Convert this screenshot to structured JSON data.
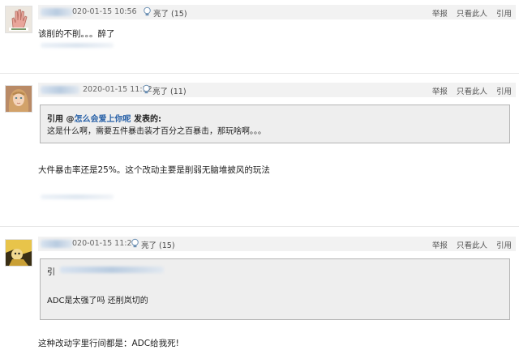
{
  "posts": [
    {
      "timestamp": "020-01-15 10:56",
      "like_label": "亮了",
      "like_count": "(15)",
      "actions": [
        "举报",
        "只看此人",
        "引用"
      ],
      "content": "该削的不削。。。醉了",
      "avatar": "hand-avatar"
    },
    {
      "timestamp": "2020-01-15 11:12",
      "like_label": "亮了",
      "like_count": "(11)",
      "actions": [
        "举报",
        "只看此人",
        "引用"
      ],
      "quote": {
        "prefix": "引用 @",
        "author": "怎么会爱上你呢",
        "suffix": " 发表的:",
        "text": "这是什么啊，需要五件暴击装才百分之百暴击，那玩啥啊。。。"
      },
      "content": "大件暴击率还是25%。这个改动主要是削弱无脑堆披风的玩法",
      "avatar": "girl-avatar"
    },
    {
      "timestamp": "020-01-15 11:26",
      "like_label": "亮了",
      "like_count": "(15)",
      "actions": [
        "举报",
        "只看此人",
        "引用"
      ],
      "quote": {
        "prefix": "引",
        "text": "ADC是太强了吗 还削岚切的"
      },
      "content": "这种改动字里行间都是：ADC给我死!",
      "avatar": "cartoon-avatar"
    }
  ],
  "colors": {
    "header_bg": "#f2f2f2",
    "quote_bg": "#eeeeee",
    "link": "#2a62a8"
  }
}
